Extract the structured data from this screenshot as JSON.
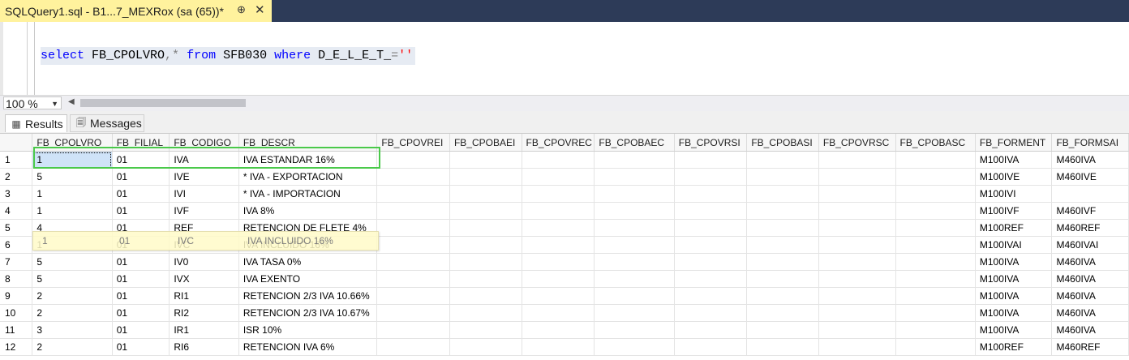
{
  "tab": {
    "title": "SQLQuery1.sql - B1...7_MEXRox (sa (65))*",
    "pin_icon": "pin-icon",
    "close_icon": "close-icon"
  },
  "editor": {
    "tokens": [
      {
        "t": "select",
        "c": "kw"
      },
      {
        "t": " FB_CPOLVRO",
        "c": "id"
      },
      {
        "t": ",*",
        "c": "op"
      },
      {
        "t": " from",
        "c": "kw"
      },
      {
        "t": " SFB030 ",
        "c": "id"
      },
      {
        "t": "where",
        "c": "kw"
      },
      {
        "t": " D_E_L_E_T_",
        "c": "id"
      },
      {
        "t": "=",
        "c": "op"
      },
      {
        "t": "''",
        "c": "str"
      }
    ]
  },
  "zoom": {
    "value": "100 %"
  },
  "results_tabs": {
    "results_label": "Results",
    "messages_label": "Messages"
  },
  "grid": {
    "columns": [
      "FB_CPOLVRO",
      "FB_FILIAL",
      "FB_CODIGO",
      "FB_DESCR",
      "FB_CPOVREI",
      "FB_CPOBAEI",
      "FB_CPOVREC",
      "FB_CPOBAEC",
      "FB_CPOVRSI",
      "FB_CPOBASI",
      "FB_CPOVRSC",
      "FB_CPOBASC",
      "FB_FORMENT",
      "FB_FORMSAI"
    ],
    "rows": [
      [
        "1",
        "1",
        "01",
        "IVA",
        "IVA ESTANDAR 16%",
        "",
        "",
        "",
        "",
        "",
        "",
        "",
        "",
        "M100IVA",
        "M460IVA"
      ],
      [
        "2",
        "5",
        "01",
        "IVE",
        "* IVA - EXPORTACION",
        "",
        "",
        "",
        "",
        "",
        "",
        "",
        "",
        "M100IVE",
        "M460IVE"
      ],
      [
        "3",
        "1",
        "01",
        "IVI",
        "* IVA - IMPORTACION",
        "",
        "",
        "",
        "",
        "",
        "",
        "",
        "",
        "M100IVI",
        ""
      ],
      [
        "4",
        "1",
        "01",
        "IVF",
        "IVA 8%",
        "",
        "",
        "",
        "",
        "",
        "",
        "",
        "",
        "M100IVF",
        "M460IVF"
      ],
      [
        "5",
        "4",
        "01",
        "REF",
        "RETENCION DE FLETE 4%",
        "",
        "",
        "",
        "",
        "",
        "",
        "",
        "",
        "M100REF",
        "M460REF"
      ],
      [
        "6",
        "1",
        "01",
        "IVC",
        "IVA INCLUIDO 16%",
        "",
        "",
        "",
        "",
        "",
        "",
        "",
        "",
        "M100IVAI",
        "M460IVAI"
      ],
      [
        "7",
        "5",
        "01",
        "IV0",
        "IVA TASA 0%",
        "",
        "",
        "",
        "",
        "",
        "",
        "",
        "",
        "M100IVA",
        "M460IVA"
      ],
      [
        "8",
        "5",
        "01",
        "IVX",
        "IVA EXENTO",
        "",
        "",
        "",
        "",
        "",
        "",
        "",
        "",
        "M100IVA",
        "M460IVA"
      ],
      [
        "9",
        "2",
        "01",
        "RI1",
        "RETENCION 2/3 IVA 10.66%",
        "",
        "",
        "",
        "",
        "",
        "",
        "",
        "",
        "M100IVA",
        "M460IVA"
      ],
      [
        "10",
        "2",
        "01",
        "RI2",
        "RETENCION 2/3 IVA 10.67%",
        "",
        "",
        "",
        "",
        "",
        "",
        "",
        "",
        "M100IVA",
        "M460IVA"
      ],
      [
        "11",
        "3",
        "01",
        "IR1",
        "ISR 10%",
        "",
        "",
        "",
        "",
        "",
        "",
        "",
        "",
        "M100IVA",
        "M460IVA"
      ],
      [
        "12",
        "2",
        "01",
        "RI6",
        "RETENCION IVA 6%",
        "",
        "",
        "",
        "",
        "",
        "",
        "",
        "",
        "M100REF",
        "M460REF"
      ]
    ]
  },
  "highlight_row6": [
    "1",
    "01",
    "IVC",
    "IVA INCLUIDO 16%"
  ],
  "colors": {
    "tab_active": "#fff29d",
    "title_bar": "#2d3b58",
    "green_box": "#4ac94a",
    "keyword": "#0000ff",
    "string": "#ff0000"
  }
}
